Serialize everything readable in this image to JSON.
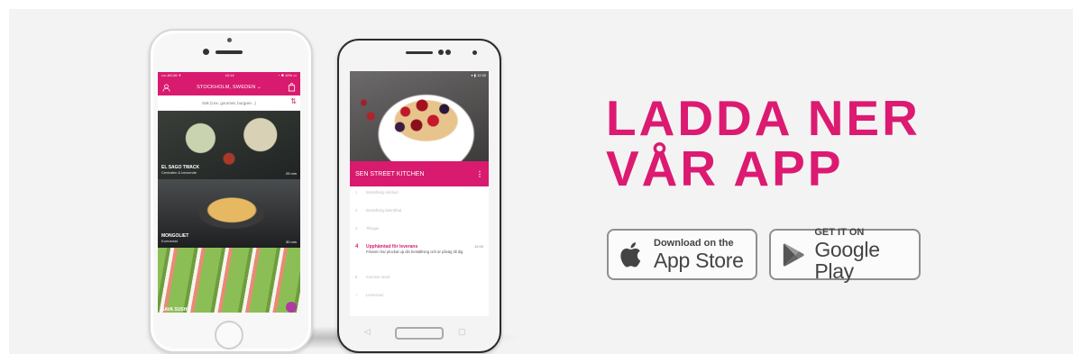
{
  "iphone": {
    "status": {
      "left": "•••• AS-06 ✈",
      "center": "10:14",
      "right": "◔ ✱ 10% ▭"
    },
    "nav": {
      "city": "STOCKHOLM, SWEDEN ⌄"
    },
    "search": {
      "placeholder": "Sök (t.ex. gourmet, burgare...)"
    },
    "restaurants": [
      {
        "name": "EL SAGO TWACK",
        "sub": "Centralen & beroende",
        "time": "25 min"
      },
      {
        "name": "MONGOLIET",
        "sub": "Koreanskt",
        "time": "30 min"
      },
      {
        "name": "SAVA SUSHI",
        "sub": "",
        "time": ""
      }
    ]
  },
  "android": {
    "status": "▾ ▮ 12:30",
    "restaurant": "SEN STREET KITCHEN",
    "steps": [
      {
        "num": "1",
        "text": "Beställning skickad"
      },
      {
        "num": "2",
        "text": "Beställning bekräftad"
      },
      {
        "num": "3",
        "text": "Tillagas"
      },
      {
        "num": "4",
        "title": "Upphämtad för leverans",
        "text": "Föraren har plockat up din beställning och är påväg till dig",
        "time": "12:00"
      },
      {
        "num": "5",
        "text": "Kommer snart"
      },
      {
        "num": "✓",
        "text": "Levererad"
      }
    ]
  },
  "headline": {
    "line1": "LADDA NER",
    "line2": "VÅR APP"
  },
  "appstore": {
    "small": "Download on the",
    "big": "App Store"
  },
  "googleplay": {
    "small": "GET IT ON",
    "big": "Google Play"
  },
  "colors": {
    "brand": "#dc1a71",
    "background": "#f3f3f3"
  }
}
